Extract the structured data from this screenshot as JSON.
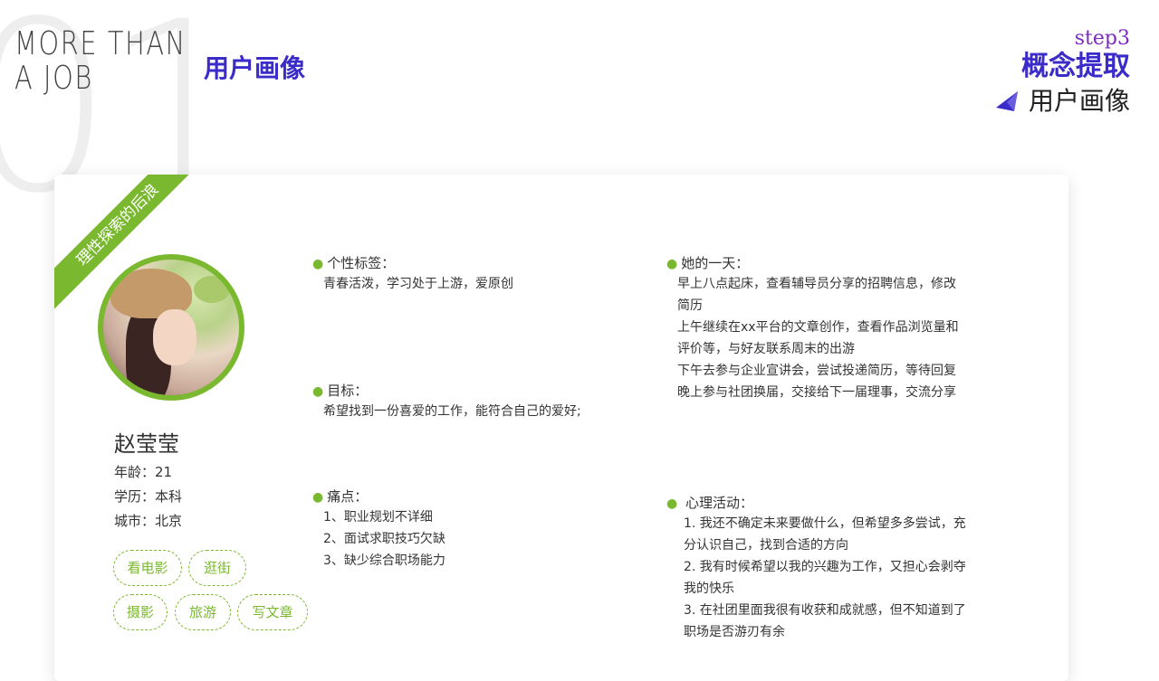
{
  "brand": {
    "line1": "MORE THAN",
    "line2": "A JOB",
    "bg_number": "01"
  },
  "section_title": "用户画像",
  "step": {
    "label": "step3",
    "title": "概念提取",
    "subtitle": "用户画像"
  },
  "colors": {
    "accent_green": "#7ab92f",
    "accent_purple": "#3b2cc9",
    "step_purple": "#7b2bbf"
  },
  "profile": {
    "ribbon": "理性探索的后浪",
    "name": "赵莹莹",
    "age": "年龄：21",
    "education": "学历：本科",
    "city": "城市：北京",
    "hobbies": [
      "看电影",
      "逛街",
      "摄影",
      "旅游",
      "写文章"
    ]
  },
  "tags_section": {
    "title": "个性标签：",
    "lines": [
      "青春活泼，学习处于上游，爱原创"
    ]
  },
  "goal_section": {
    "title": "目标：",
    "lines": [
      "希望找到一份喜爱的工作，能符合自己的爱好;"
    ]
  },
  "pain_section": {
    "title": "痛点：",
    "lines": [
      "1、职业规划不详细",
      "2、面试求职技巧欠缺",
      "3、缺少综合职场能力"
    ]
  },
  "day_section": {
    "title": "她的一天：",
    "lines": [
      "早上八点起床，查看辅导员分享的招聘信息，修改",
      "简历",
      "上午继续在xx平台的文章创作，查看作品浏览量和",
      "评价等，与好友联系周末的出游",
      "下午去参与企业宣讲会，尝试投递简历，等待回复",
      "晚上参与社团换届，交接给下一届理事，交流分享"
    ]
  },
  "mind_section": {
    "title": "心理活动：",
    "lines": [
      "1. 我还不确定未来要做什么，但希望多多尝试，充",
      "分认识自己，找到合适的方向",
      "2. 我有时候希望以我的兴趣为工作，又担心会剥夺",
      "我的快乐",
      "3. 在社团里面我很有收获和成就感，但不知道到了",
      "职场是否游刃有余"
    ]
  }
}
